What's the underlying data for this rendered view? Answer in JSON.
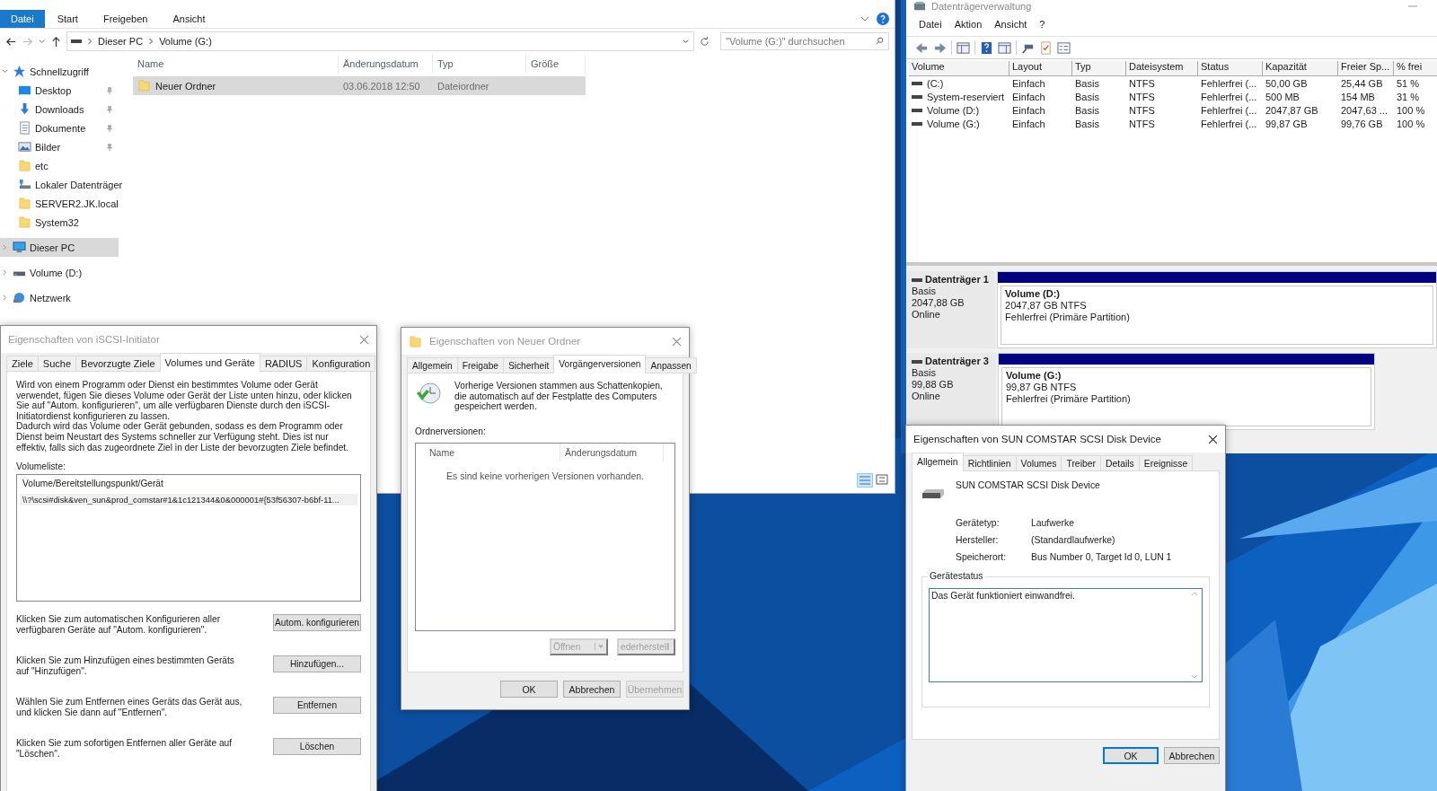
{
  "explorer": {
    "ribbon_tabs": [
      {
        "label": "Datei",
        "selected": true
      },
      {
        "label": "Start",
        "selected": false
      },
      {
        "label": "Freigeben",
        "selected": false
      },
      {
        "label": "Ansicht",
        "selected": false
      }
    ],
    "breadcrumbs": [
      "Dieser PC",
      "Volume (G:)"
    ],
    "search": {
      "placeholder": "\"Volume (G:)\" durchsuchen"
    },
    "nav": [
      {
        "label": "Schnellzugriff",
        "kind": "star",
        "expanded": true,
        "selected": false,
        "children": [
          {
            "label": "Desktop",
            "kind": "desktop",
            "pinned": true,
            "selected": false
          },
          {
            "label": "Downloads",
            "kind": "download",
            "pinned": true,
            "selected": false
          },
          {
            "label": "Dokumente",
            "kind": "document",
            "pinned": true,
            "selected": false
          },
          {
            "label": "Bilder",
            "kind": "pictures",
            "pinned": true,
            "selected": false
          },
          {
            "label": "etc",
            "kind": "folder",
            "pinned": false,
            "selected": false
          },
          {
            "label": "Lokaler Datenträger",
            "kind": "netdrive",
            "pinned": false,
            "selected": false
          },
          {
            "label": "SERVER2.JK.local",
            "kind": "folder",
            "pinned": false,
            "selected": false
          },
          {
            "label": "System32",
            "kind": "folder",
            "pinned": false,
            "selected": false
          }
        ]
      },
      {
        "label": "Dieser PC",
        "kind": "pc",
        "expanded": false,
        "selected": true
      },
      {
        "label": "Volume (D:)",
        "kind": "drive",
        "expanded": false,
        "selected": false
      },
      {
        "label": "Netzwerk",
        "kind": "network",
        "expanded": false,
        "selected": false
      }
    ],
    "columns": [
      "Name",
      "Änderungsdatum",
      "Typ",
      "Größe"
    ],
    "files": [
      {
        "name": "Neuer Ordner",
        "date": "03.06.2018 12:50",
        "type": "Dateiordner",
        "selected": true
      }
    ]
  },
  "disk_management": {
    "title": "Datenträgerverwaltung",
    "menu": [
      "Datei",
      "Aktion",
      "Ansicht",
      "?"
    ],
    "columns": [
      "Volume",
      "Layout",
      "Typ",
      "Dateisystem",
      "Status",
      "Kapazität",
      "Freier Sp...",
      "% frei"
    ],
    "rows": [
      [
        "(C:)",
        "Einfach",
        "Basis",
        "NTFS",
        "Fehlerfrei (...",
        "50,00 GB",
        "25,44 GB",
        "51 %"
      ],
      [
        "System-reserviert",
        "Einfach",
        "Basis",
        "NTFS",
        "Fehlerfrei (...",
        "500 MB",
        "154 MB",
        "31 %"
      ],
      [
        "Volume (D:)",
        "Einfach",
        "Basis",
        "NTFS",
        "Fehlerfrei (...",
        "2047,87 GB",
        "2047,63 ...",
        "100 %"
      ],
      [
        "Volume (G:)",
        "Einfach",
        "Basis",
        "NTFS",
        "Fehlerfrei (...",
        "99,87 GB",
        "99,76 GB",
        "100 %"
      ]
    ],
    "disks": [
      {
        "name": "Datenträger 1",
        "type": "Basis",
        "size": "2047,88 GB",
        "state": "Online",
        "partition": {
          "name": "Volume  (D:)",
          "size": "2047,87 GB NTFS",
          "status": "Fehlerfrei (Primäre Partition)"
        }
      },
      {
        "name": "Datenträger 3",
        "type": "Basis",
        "size": "99,88 GB",
        "state": "Online",
        "partition": {
          "name": "Volume  (G:)",
          "size": "99,87 GB NTFS",
          "status": "Fehlerfrei (Primäre Partition)"
        }
      }
    ]
  },
  "iscsi_dialog": {
    "title": "Eigenschaften von iSCSI-Initiator",
    "tabs": [
      {
        "label": "Ziele",
        "selected": false
      },
      {
        "label": "Suche",
        "selected": false
      },
      {
        "label": "Bevorzugte Ziele",
        "selected": false
      },
      {
        "label": "Volumes und Geräte",
        "selected": true
      },
      {
        "label": "RADIUS",
        "selected": false
      },
      {
        "label": "Konfiguration",
        "selected": false
      }
    ],
    "description": [
      "Wird von einem Programm oder Dienst ein bestimmtes Volume oder Gerät verwendet, fügen Sie dieses Volume oder Gerät der Liste unten hinzu, oder klicken Sie auf \"Autom. konfigurieren\", um alle verfügbaren Dienste durch den iSCSI-Initiatordienst konfigurieren zu lassen.",
      "Dadurch wird das Volume oder Gerät gebunden, sodass es dem Programm oder Dienst beim Neustart des Systems schneller zur Verfügung steht. Dies ist nur effektiv, falls sich das zugeordnete Ziel in der Liste der bevorzugten Ziele befindet."
    ],
    "list_label": "Volumeliste:",
    "list_header": "Volume/Bereitstellungspunkt/Gerät",
    "list_items": [
      "\\\\?\\scsi#disk&ven_sun&prod_comstar#1&1c121344&0&000001#{53f56307-b6bf-11..."
    ],
    "actions": [
      {
        "text": "Klicken Sie zum automatischen Konfigurieren aller verfügbaren Geräte auf \"Autom. konfigurieren\".",
        "button": "Autom. konfigurieren"
      },
      {
        "text": "Klicken Sie zum Hinzufügen eines bestimmten Geräts auf \"Hinzufügen\".",
        "button": "Hinzufügen..."
      },
      {
        "text": "Wählen Sie zum Entfernen eines Geräts das Gerät aus, und klicken Sie dann auf \"Entfernen\".",
        "button": "Entfernen"
      },
      {
        "text": "Klicken Sie zum sofortigen Entfernen aller Geräte auf \"Löschen\".",
        "button": "Löschen"
      }
    ]
  },
  "folder_dialog": {
    "title": "Eigenschaften von Neuer Ordner",
    "tabs": [
      {
        "label": "Allgemein",
        "selected": false
      },
      {
        "label": "Freigabe",
        "selected": false
      },
      {
        "label": "Sicherheit",
        "selected": false
      },
      {
        "label": "Vorgängerversionen",
        "selected": true
      },
      {
        "label": "Anpassen",
        "selected": false
      }
    ],
    "info": "Vorherige Versionen stammen aus Schattenkopien, die automatisch auf der Festplatte des Computers gespeichert werden.",
    "list_label": "Ordnerversionen:",
    "columns": [
      "Name",
      "Änderungsdatum"
    ],
    "empty_message": "Es sind keine vorherigen Versionen vorhanden.",
    "split_buttons": [
      {
        "label": "Öffnen",
        "disabled": true
      },
      {
        "label": "ederherstell",
        "disabled": true
      }
    ],
    "buttons": [
      {
        "label": "OK",
        "disabled": false
      },
      {
        "label": "Abbrechen",
        "disabled": false
      },
      {
        "label": "Übernehmen",
        "disabled": true
      }
    ]
  },
  "device_dialog": {
    "title": "Eigenschaften von SUN COMSTAR SCSI Disk Device",
    "tabs": [
      {
        "label": "Allgemein",
        "selected": true
      },
      {
        "label": "Richtlinien",
        "selected": false
      },
      {
        "label": "Volumes",
        "selected": false
      },
      {
        "label": "Treiber",
        "selected": false
      },
      {
        "label": "Details",
        "selected": false
      },
      {
        "label": "Ereignisse",
        "selected": false
      }
    ],
    "device_name": "SUN COMSTAR SCSI Disk Device",
    "properties": [
      {
        "label": "Gerätetyp:",
        "value": "Laufwerke"
      },
      {
        "label": "Hersteller:",
        "value": "(Standardlaufwerke)"
      },
      {
        "label": "Speicherort:",
        "value": "Bus Number 0, Target Id 0, LUN 1"
      }
    ],
    "status_group": "Gerätestatus",
    "status_text": "Das Gerät funktioniert einwandfrei.",
    "buttons": [
      {
        "label": "OK",
        "default": true
      },
      {
        "label": "Abbrechen",
        "default": false
      }
    ]
  }
}
